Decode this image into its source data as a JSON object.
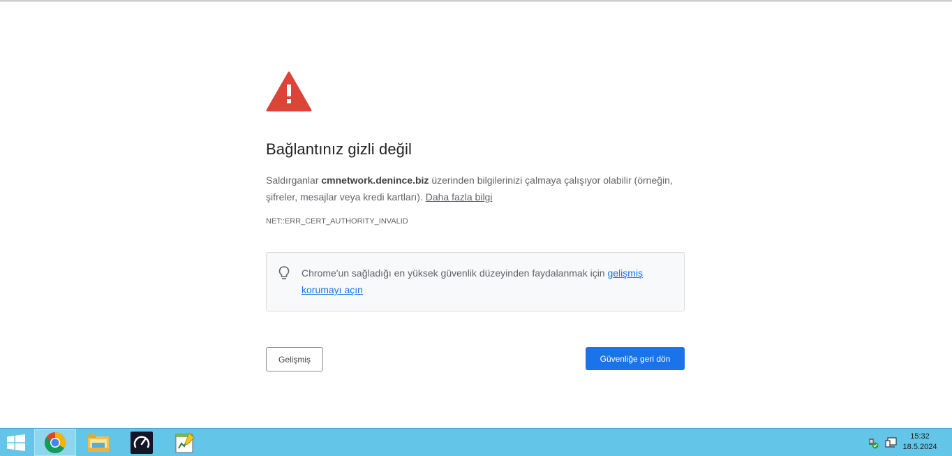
{
  "error_page": {
    "heading": "Bağlantınız gizli değil",
    "message_prefix": "Saldırganlar ",
    "domain": "cmnetwork.denince.biz",
    "message_suffix": " üzerinden bilgilerinizi çalmaya çalışıyor olabilir (örneğin, şifreler, mesajlar veya kredi kartları). ",
    "learn_more": "Daha fazla bilgi",
    "error_code": "NET::ERR_CERT_AUTHORITY_INVALID",
    "promo_text": "Chrome'un sağladığı en yüksek güvenlik düzeyinden faydalanmak için ",
    "promo_link": "gelişmiş korumayı açın",
    "advanced_button": "Gelişmiş",
    "back_button": "Güvenliğe geri dön",
    "colors": {
      "warning": "#db4437",
      "primary": "#1a73e8",
      "text": "#5f6368"
    }
  },
  "taskbar": {
    "start_icon": "windows-start-icon",
    "apps": [
      {
        "name": "chrome-icon",
        "active": true
      },
      {
        "name": "file-explorer-icon",
        "active": false
      },
      {
        "name": "speedometer-icon",
        "active": false
      },
      {
        "name": "notepad-chart-icon",
        "active": false
      }
    ],
    "tray_icons": [
      "network-shield-icon",
      "network-monitor-icon"
    ],
    "time": "15:32",
    "date": "18.5.2024",
    "color": "#63c6e8"
  }
}
